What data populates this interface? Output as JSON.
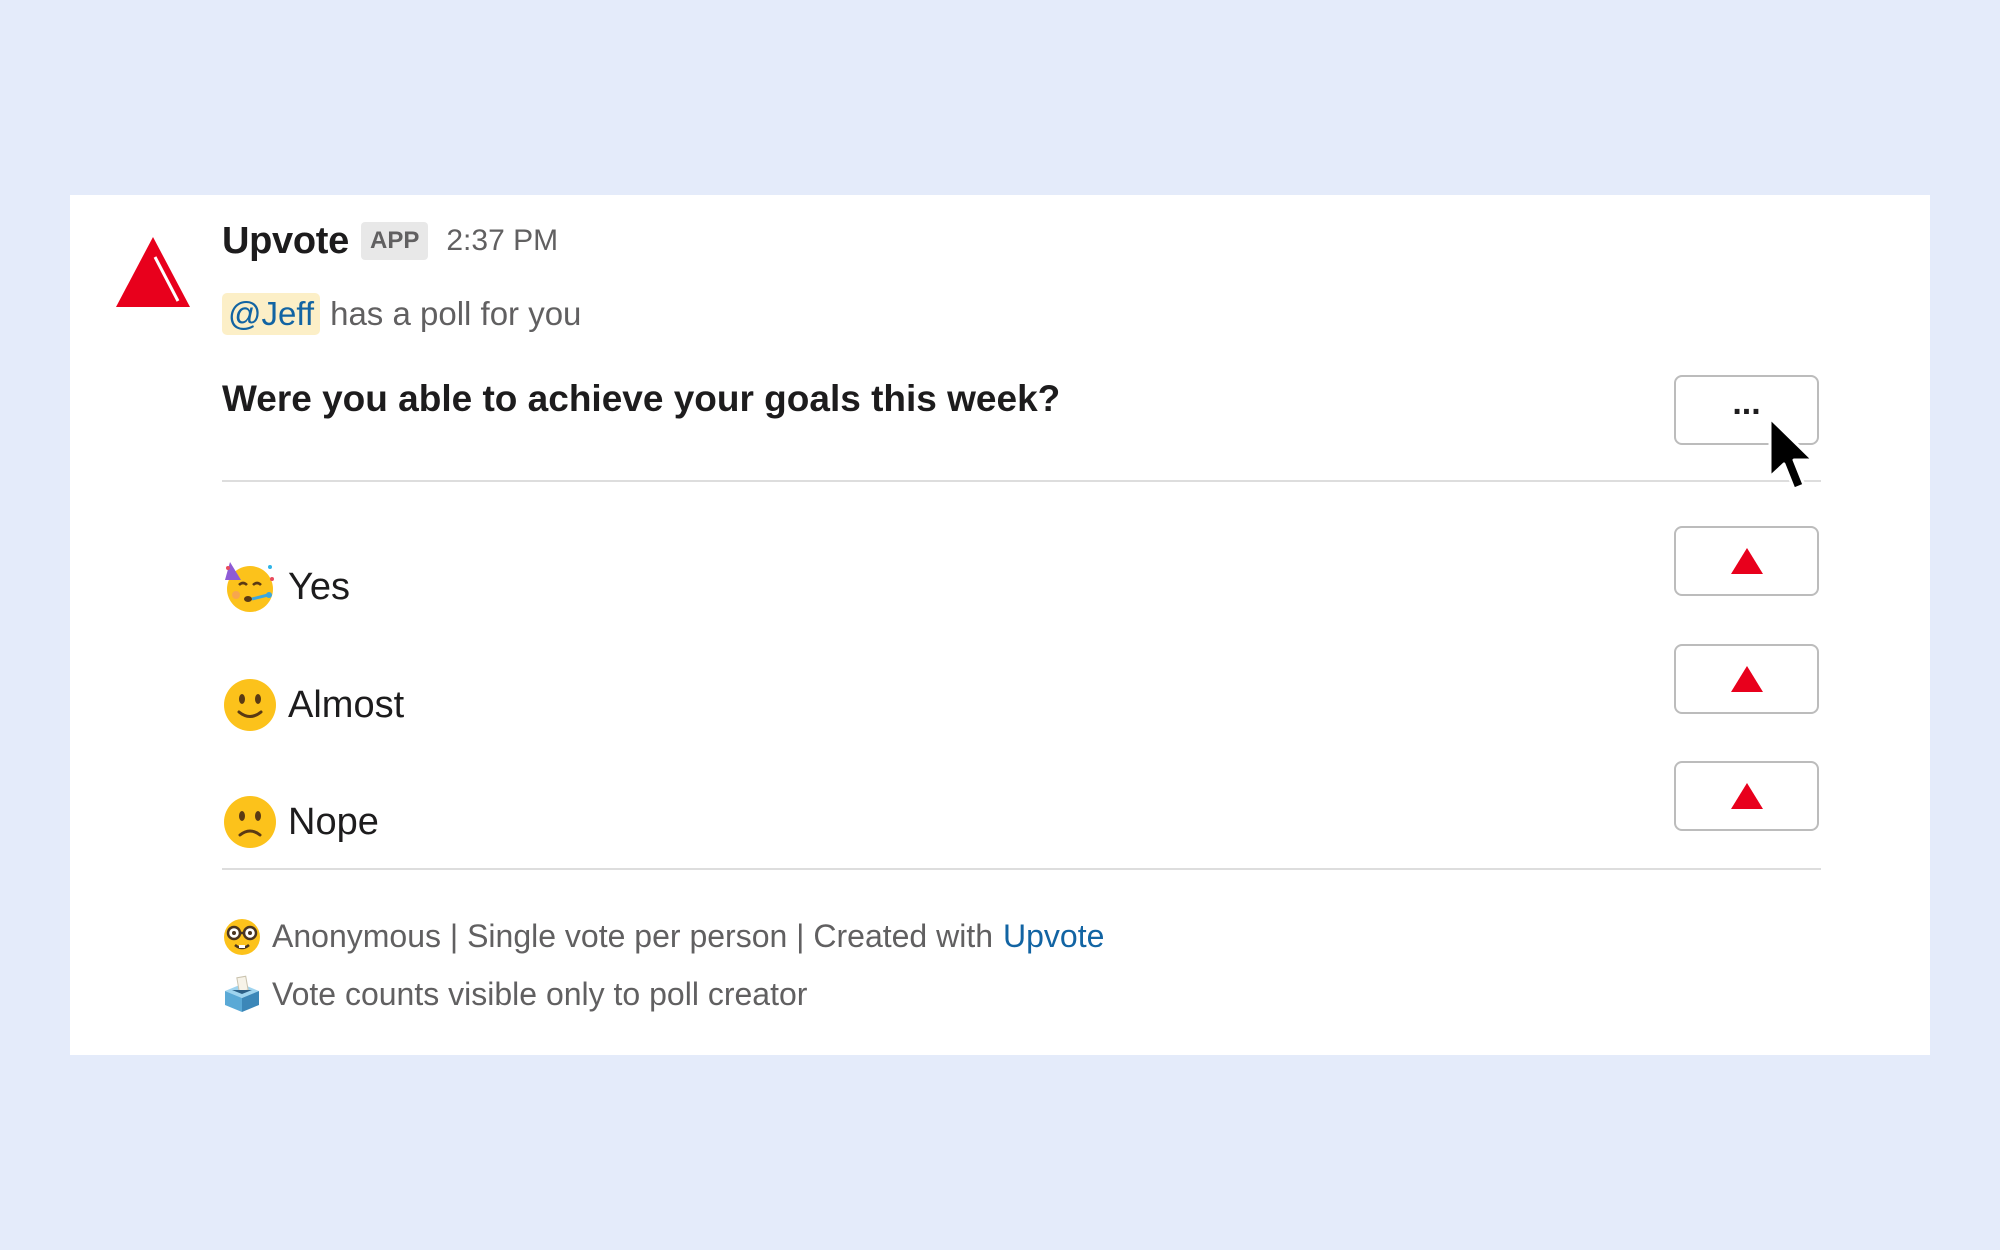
{
  "message": {
    "app_name": "Upvote",
    "app_badge": "APP",
    "timestamp": "2:37 PM",
    "mention": "@Jeff",
    "intro_text": "has a poll for you"
  },
  "poll": {
    "question": "Were you able to achieve your goals this week?",
    "more_button_label": "...",
    "options": [
      {
        "emoji": "partying-face-icon",
        "label": "Yes"
      },
      {
        "emoji": "slightly-smiling-face-icon",
        "label": "Almost"
      },
      {
        "emoji": "slightly-frowning-face-icon",
        "label": "Nope"
      }
    ]
  },
  "footer": {
    "settings_text": "Anonymous | Single vote per person | Created with",
    "settings_link": "Upvote",
    "visibility_text": "Vote counts visible only to poll creator"
  },
  "colors": {
    "background": "#e4ebfa",
    "upvote_red": "#e8001c",
    "link": "#1264a3",
    "mention_bg": "#fcefc7"
  }
}
